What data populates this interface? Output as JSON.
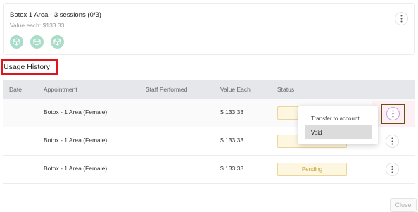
{
  "package": {
    "title": "Botox 1 Area - 3 sessions (0/3)",
    "value_each": "Value each: $133.33",
    "session_icons": [
      "box-icon",
      "box-icon",
      "box-icon"
    ]
  },
  "usage_history": {
    "title": "Usage History"
  },
  "table": {
    "headers": {
      "date": "Date",
      "appointment": "Appointment",
      "staff": "Staff Performed",
      "value": "Value Each",
      "status": "Status"
    },
    "rows": [
      {
        "date": "",
        "appointment": "Botox - 1 Area (Female)",
        "staff": "",
        "value": "$ 133.33",
        "status": "Pending"
      },
      {
        "date": "",
        "appointment": "Botox - 1 Area (Female)",
        "staff": "",
        "value": "$ 133.33",
        "status": "Pending"
      },
      {
        "date": "",
        "appointment": "Botox - 1 Area (Female)",
        "staff": "",
        "value": "$ 133.33",
        "status": "Pending"
      }
    ]
  },
  "menu": {
    "items": [
      "Transfer to account",
      "Void"
    ],
    "active_index": 1
  },
  "footer": {
    "close_label": "Close"
  },
  "colors": {
    "session_icon_bg": "#a9dcc9",
    "pending_badge_bg": "#fdf7e1",
    "pending_badge_text": "#c9a33a",
    "highlight_red": "#e0141e",
    "highlight_brown": "#6b4e12",
    "header_bg": "#e6e7eb"
  }
}
